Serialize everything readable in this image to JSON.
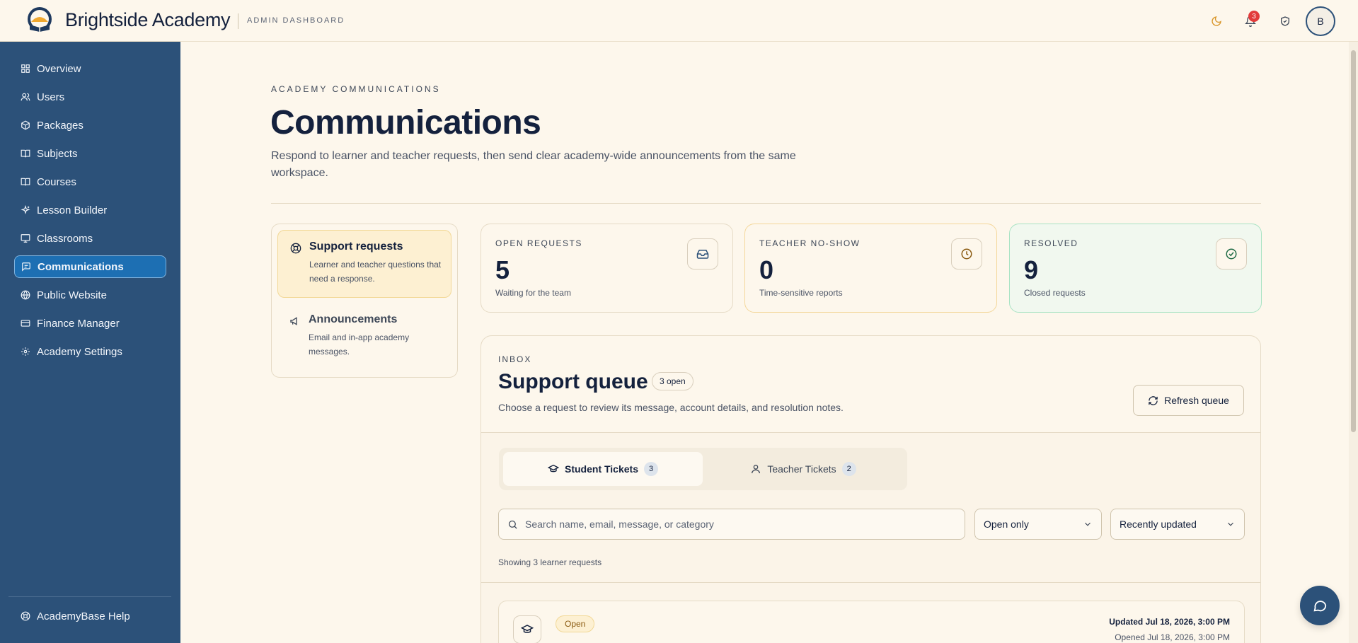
{
  "header": {
    "brand": "Brightside Academy",
    "subtitle": "ADMIN DASHBOARD",
    "notification_count": "3",
    "avatar_initial": "B"
  },
  "sidebar": {
    "items": [
      {
        "label": "Overview",
        "icon": "grid-icon"
      },
      {
        "label": "Users",
        "icon": "users-icon"
      },
      {
        "label": "Packages",
        "icon": "package-icon"
      },
      {
        "label": "Subjects",
        "icon": "book-icon"
      },
      {
        "label": "Courses",
        "icon": "book-open-icon"
      },
      {
        "label": "Lesson Builder",
        "icon": "sparkles-icon"
      },
      {
        "label": "Classrooms",
        "icon": "monitor-icon"
      },
      {
        "label": "Communications",
        "icon": "message-icon",
        "active": true
      },
      {
        "label": "Public Website",
        "icon": "globe-icon"
      },
      {
        "label": "Finance Manager",
        "icon": "wallet-icon"
      },
      {
        "label": "Academy Settings",
        "icon": "gear-icon"
      }
    ],
    "help": "AcademyBase Help"
  },
  "main": {
    "eyebrow": "ACADEMY COMMUNICATIONS",
    "title": "Communications",
    "description": "Respond to learner and teacher requests, then send clear academy-wide announcements from the same workspace."
  },
  "tabs": [
    {
      "title": "Support requests",
      "desc": "Learner and teacher questions that need a response."
    },
    {
      "title": "Announcements",
      "desc": "Email and in-app academy messages."
    }
  ],
  "stats": [
    {
      "label": "OPEN REQUESTS",
      "value": "5",
      "desc": "Waiting for the team"
    },
    {
      "label": "TEACHER NO-SHOW",
      "value": "0",
      "desc": "Time-sensitive reports"
    },
    {
      "label": "RESOLVED",
      "value": "9",
      "desc": "Closed requests"
    }
  ],
  "inbox": {
    "eyebrow": "INBOX",
    "title": "Support queue",
    "open_count": "3 open",
    "description": "Choose a request to review its message, account details, and resolution notes.",
    "refresh_label": "Refresh queue",
    "segments": [
      {
        "label": "Student Tickets",
        "count": "3"
      },
      {
        "label": "Teacher Tickets",
        "count": "2"
      }
    ],
    "search_placeholder": "Search name, email, message, or category",
    "status_filter": "Open only",
    "sort": "Recently updated",
    "showing": "Showing 3 learner requests",
    "ticket": {
      "status": "Open",
      "updated": "Updated Jul 18, 2026, 3:00 PM",
      "opened": "Opened Jul 18, 2026, 3:00 PM"
    }
  },
  "colors": {
    "sidebar": "#2c5179",
    "active": "#1d6fb3",
    "background": "#fdf7ec",
    "badge": "#e23b3b"
  }
}
